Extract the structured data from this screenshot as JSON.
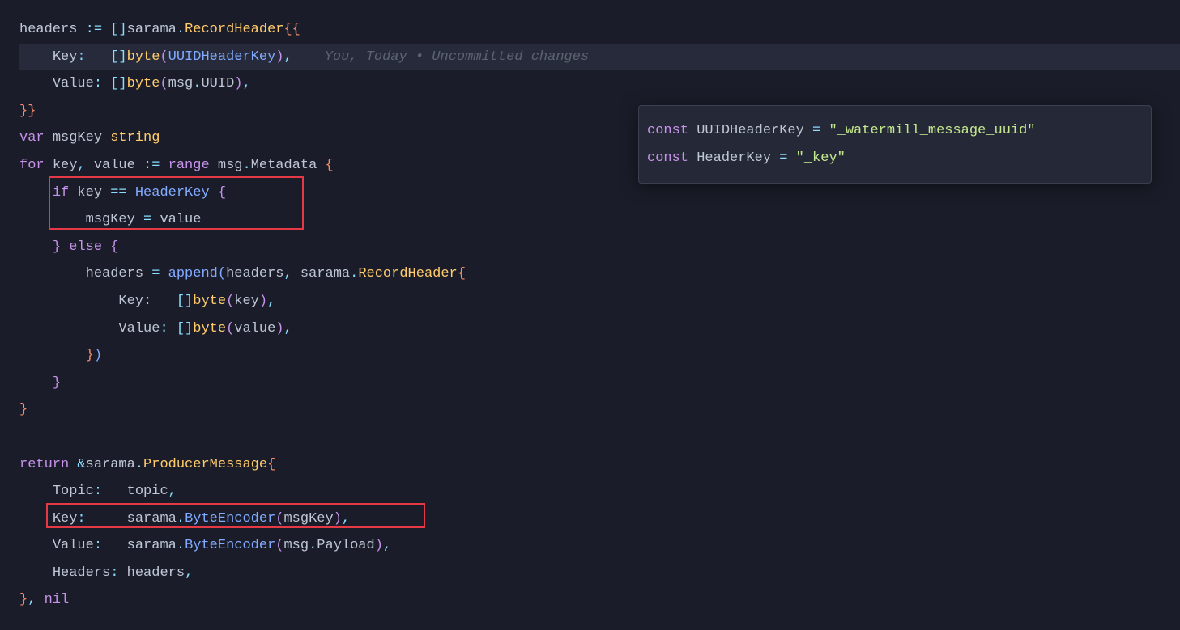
{
  "code": {
    "line1": {
      "ident": "headers ",
      "op": ":=",
      "bracket_open": " []",
      "pkg": "sarama",
      "dot": ".",
      "type": "RecordHeader",
      "brace_open": "{{"
    },
    "line2": {
      "indent": "    ",
      "prop": "Key",
      "colon": ":   ",
      "bracket": "[]",
      "type": "byte",
      "paren_open": "(",
      "const": "UUIDHeaderKey",
      "paren_close": ")",
      "comma": ",",
      "annotation": "You, Today • Uncommitted changes"
    },
    "line3": {
      "indent": "    ",
      "prop": "Value",
      "colon": ": ",
      "bracket": "[]",
      "type": "byte",
      "paren_open": "(",
      "ident": "msg",
      "dot": ".",
      "field": "UUID",
      "paren_close": ")",
      "comma": ","
    },
    "line4": {
      "brace_close": "}}"
    },
    "line5": {
      "kw": "var",
      "sp": " ",
      "ident": "msgKey ",
      "type": "string"
    },
    "line6": {
      "kw": "for",
      "sp": " ",
      "ident1": "key",
      "comma": ", ",
      "ident2": "value ",
      "op": ":=",
      "sp2": " ",
      "kw2": "range",
      "sp3": " ",
      "ident3": "msg",
      "dot": ".",
      "field": "Metadata",
      "sp4": " ",
      "brace": "{"
    },
    "line7": {
      "indent": "    ",
      "kw": "if",
      "sp": " ",
      "ident": "key ",
      "op": "==",
      "sp2": " ",
      "const": "HeaderKey",
      "sp3": " ",
      "brace": "{"
    },
    "line8": {
      "indent": "        ",
      "ident": "msgKey ",
      "op": "=",
      "sp": " ",
      "ident2": "value"
    },
    "line9": {
      "indent": "    ",
      "brace_close": "}",
      "sp": " ",
      "kw": "else",
      "sp2": " ",
      "brace_open": "{"
    },
    "line10": {
      "indent": "        ",
      "ident": "headers ",
      "op": "=",
      "sp": " ",
      "func": "append",
      "paren_open": "(",
      "arg1": "headers",
      "comma": ", ",
      "pkg": "sarama",
      "dot": ".",
      "type": "RecordHeader",
      "brace": "{"
    },
    "line11": {
      "indent": "            ",
      "prop": "Key",
      "colon": ":   ",
      "bracket": "[]",
      "type": "byte",
      "paren_open": "(",
      "ident": "key",
      "paren_close": ")",
      "comma": ","
    },
    "line12": {
      "indent": "            ",
      "prop": "Value",
      "colon": ": ",
      "bracket": "[]",
      "type": "byte",
      "paren_open": "(",
      "ident": "value",
      "paren_close": ")",
      "comma": ","
    },
    "line13": {
      "indent": "        ",
      "brace": "}",
      "paren": ")"
    },
    "line14": {
      "indent": "    ",
      "brace": "}"
    },
    "line15": {
      "brace": "}"
    },
    "line16": {
      "empty": ""
    },
    "line17": {
      "kw": "return",
      "sp": " ",
      "op": "&",
      "pkg": "sarama",
      "dot": ".",
      "type": "ProducerMessage",
      "brace": "{"
    },
    "line18": {
      "indent": "    ",
      "prop": "Topic",
      "colon": ":   ",
      "ident": "topic",
      "comma": ","
    },
    "line19": {
      "indent": "    ",
      "prop": "Key",
      "colon": ":     ",
      "pkg": "sarama",
      "dot": ".",
      "func": "ByteEncoder",
      "paren_open": "(",
      "ident": "msgKey",
      "paren_close": ")",
      "comma": ","
    },
    "line20": {
      "indent": "    ",
      "prop": "Value",
      "colon": ":   ",
      "pkg": "sarama",
      "dot": ".",
      "func": "ByteEncoder",
      "paren_open": "(",
      "ident": "msg",
      "dot2": ".",
      "field": "Payload",
      "paren_close": ")",
      "comma": ","
    },
    "line21": {
      "indent": "    ",
      "prop": "Headers",
      "colon": ": ",
      "ident": "headers",
      "comma": ","
    },
    "line22": {
      "brace": "}",
      "comma": ", ",
      "kw": "nil"
    }
  },
  "popup": {
    "line1": {
      "kw": "const",
      "sp": " ",
      "ident": "UUIDHeaderKey ",
      "op": "=",
      "sp2": " ",
      "str": "\"_watermill_message_uuid\""
    },
    "line2": {
      "kw": "const",
      "sp": " ",
      "ident": "HeaderKey ",
      "op": "=",
      "sp2": " ",
      "str": "\"_key\""
    }
  }
}
